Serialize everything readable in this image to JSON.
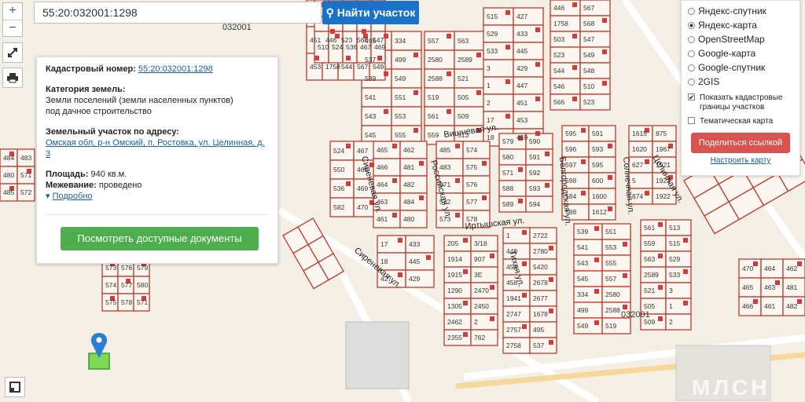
{
  "search": {
    "value": "55:20:032001:1298",
    "button_label": "Найти участок"
  },
  "zoom": {
    "in": "+",
    "out": "−"
  },
  "info": {
    "cad_label": "Кадастровый номер:",
    "cad_value": "55:20:032001:1298",
    "category_label": "Категория земель:",
    "category_value": "Земли поселений (земли населенных пунктов)",
    "category_value2": "под дачное строительство",
    "address_label": "Земельный участок по адресу:",
    "address_value": "Омская обл, р-н Омский, п. Ростовка, ул. Целинная, д. 3",
    "area_label": "Площадь:",
    "area_value": "940 кв.м.",
    "survey_label": "Межевание:",
    "survey_value": "проведено",
    "more_label": "Подробно",
    "docs_button": "Посмотреть доступные документы"
  },
  "layers": {
    "options": [
      {
        "label": "Яндекс-спутник",
        "selected": false
      },
      {
        "label": "Яндекс-карта",
        "selected": true
      },
      {
        "label": "OpenStreetMap",
        "selected": false
      },
      {
        "label": "Google-карта",
        "selected": false
      },
      {
        "label": "Google-спутник",
        "selected": false
      },
      {
        "label": "2GIS",
        "selected": false
      }
    ],
    "show_borders_label": "Показать кадастровые границы участков",
    "show_borders_checked": true,
    "thematic_label": "Тематическая карта",
    "thematic_checked": false,
    "share_button": "Поделиться ссылкой",
    "tune_link": "Настроить карту"
  },
  "watermark": "МЛСН",
  "map": {
    "streets": [
      "Вишневая ул.",
      "Иртышская ул.",
      "Сиреневая ул.",
      "Сиреневая ул.",
      "Российская ул.",
      "Тихая ул.",
      "Белгородская ул.",
      "Солнечная ул.",
      "Целинная ул."
    ],
    "quarter_labels": [
      "032001",
      "032001",
      "032001"
    ],
    "parcel_labels": [
      "495",
      "537",
      "539",
      "541",
      "543",
      "545",
      "334",
      "499",
      "549",
      "551",
      "553",
      "555",
      "557",
      "2580",
      "2588",
      "519",
      "561",
      "559",
      "563",
      "2589",
      "521",
      "505",
      "509",
      "513",
      "515",
      "529",
      "533",
      "3",
      "1",
      "2",
      "17",
      "18",
      "427",
      "433",
      "445",
      "429",
      "447",
      "451",
      "453",
      "459",
      "446",
      "1758",
      "503",
      "523",
      "544",
      "546",
      "566",
      "567",
      "568",
      "547",
      "549",
      "548",
      "510",
      "523",
      "524",
      "550",
      "536",
      "582",
      "467",
      "468",
      "469",
      "470",
      "465",
      "466",
      "464",
      "463",
      "461",
      "462",
      "481",
      "482",
      "484",
      "480",
      "485",
      "483",
      "571",
      "572",
      "573",
      "574",
      "575",
      "576",
      "577",
      "578",
      "579",
      "580",
      "571",
      "588",
      "589",
      "590",
      "591",
      "592",
      "593",
      "594",
      "595",
      "596",
      "597",
      "598",
      "584",
      "588",
      "591",
      "593",
      "595",
      "600",
      "1600",
      "1612",
      "1615",
      "1620",
      "627",
      "5",
      "874",
      "875",
      "1967",
      "1921",
      "1923",
      "1922",
      "205",
      "1914",
      "1915",
      "1290",
      "1305",
      "2462",
      "2355",
      "3/18",
      "907",
      "3E",
      "2470",
      "2450",
      "2",
      "762",
      "1",
      "440",
      "454",
      "458",
      "1941",
      "2747",
      "2757",
      "2758",
      "2722",
      "2780",
      "5420",
      "2678",
      "2677",
      "1678"
    ]
  },
  "colors": {
    "accent": "#1a73c8",
    "docs": "#4cae4c",
    "share": "#d9534f",
    "parcel_line": "#c0392b"
  }
}
